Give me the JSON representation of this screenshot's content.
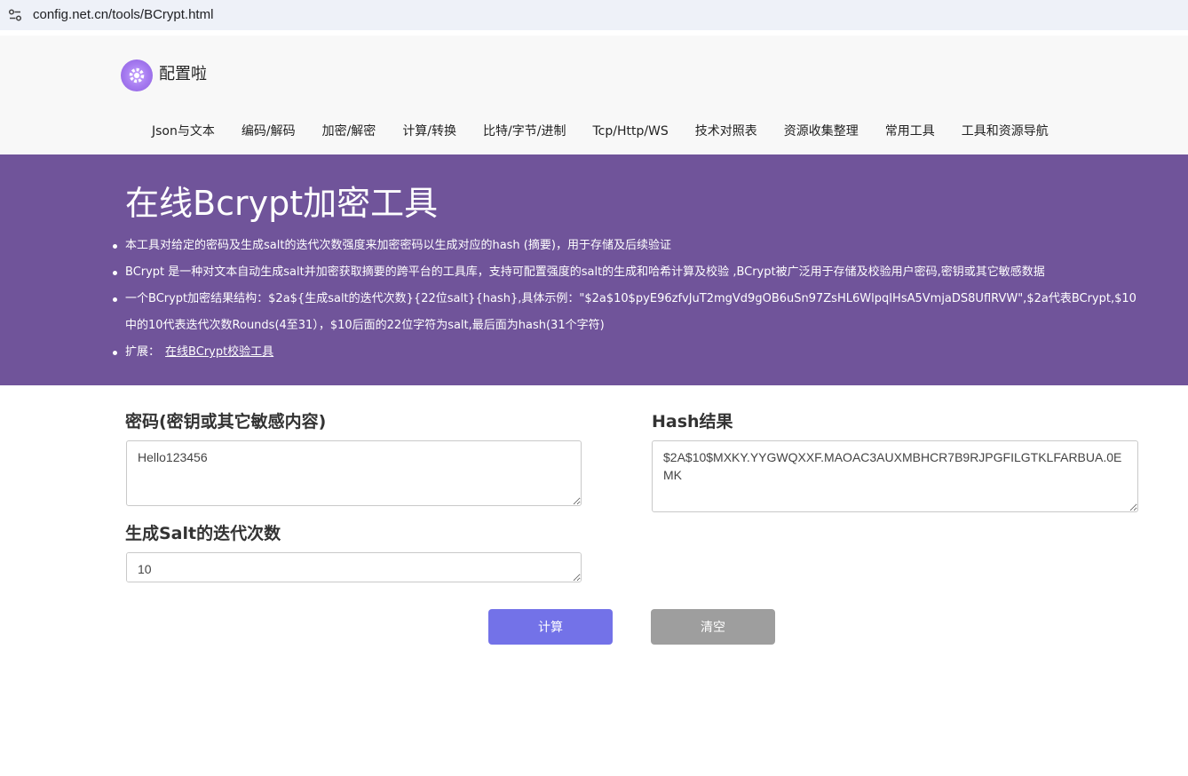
{
  "browser": {
    "url": "config.net.cn/tools/BCrypt.html",
    "site_icon": "site-settings-icon"
  },
  "header": {
    "logo_icon": "gear-logo-icon",
    "site_name": "配置啦",
    "nav": [
      {
        "label": "Json与文本"
      },
      {
        "label": "编码/解码"
      },
      {
        "label": "加密/解密"
      },
      {
        "label": "计算/转换"
      },
      {
        "label": "比特/字节/进制"
      },
      {
        "label": "Tcp/Http/WS"
      },
      {
        "label": "技术对照表"
      },
      {
        "label": "资源收集整理"
      },
      {
        "label": "常用工具"
      },
      {
        "label": "工具和资源导航"
      }
    ]
  },
  "banner": {
    "title": "在线Bcrypt加密工具",
    "items": [
      "本工具对给定的密码及生成salt的迭代次数强度来加密密码以生成对应的hash (摘要)，用于存储及后续验证",
      "BCrypt 是一种对文本自动生成salt并加密获取摘要的跨平台的工具库，支持可配置强度的salt的生成和哈希计算及校验 ,BCrypt被广泛用于存储及校验用户密码,密钥或其它敏感数据",
      "一个BCrypt加密结果结构：$2a${生成salt的迭代次数}{22位salt}{hash},具体示例：\"$2a$10$pyE96zfvJuT2mgVd9gOB6uSn97ZsHL6WlpqIHsA5VmjaDS8UflRVW\",$2a代表BCrypt,$10中的10代表迭代次数Rounds(4至31），$10后面的22位字符为salt,最后面为hash(31个字符)"
    ],
    "extension_prefix": "扩展：",
    "extension_link": "在线BCrypt校验工具"
  },
  "form": {
    "password_label": "密码(密钥或其它敏感内容)",
    "password_value": "Hello123456",
    "rounds_label": "生成Salt的迭代次数",
    "rounds_value": "10",
    "hash_label": "Hash结果",
    "hash_value": "$2A$10$MXKY.YYGWQXXF.MAOAC3AUXMBHCR7B9RJPGFILGTKLFARBUA.0EMK",
    "calc_button": "计算",
    "clear_button": "清空"
  },
  "colors": {
    "banner_bg": "#70549a",
    "calc_button_bg": "#7372e8",
    "clear_button_bg": "#9e9e9e"
  }
}
